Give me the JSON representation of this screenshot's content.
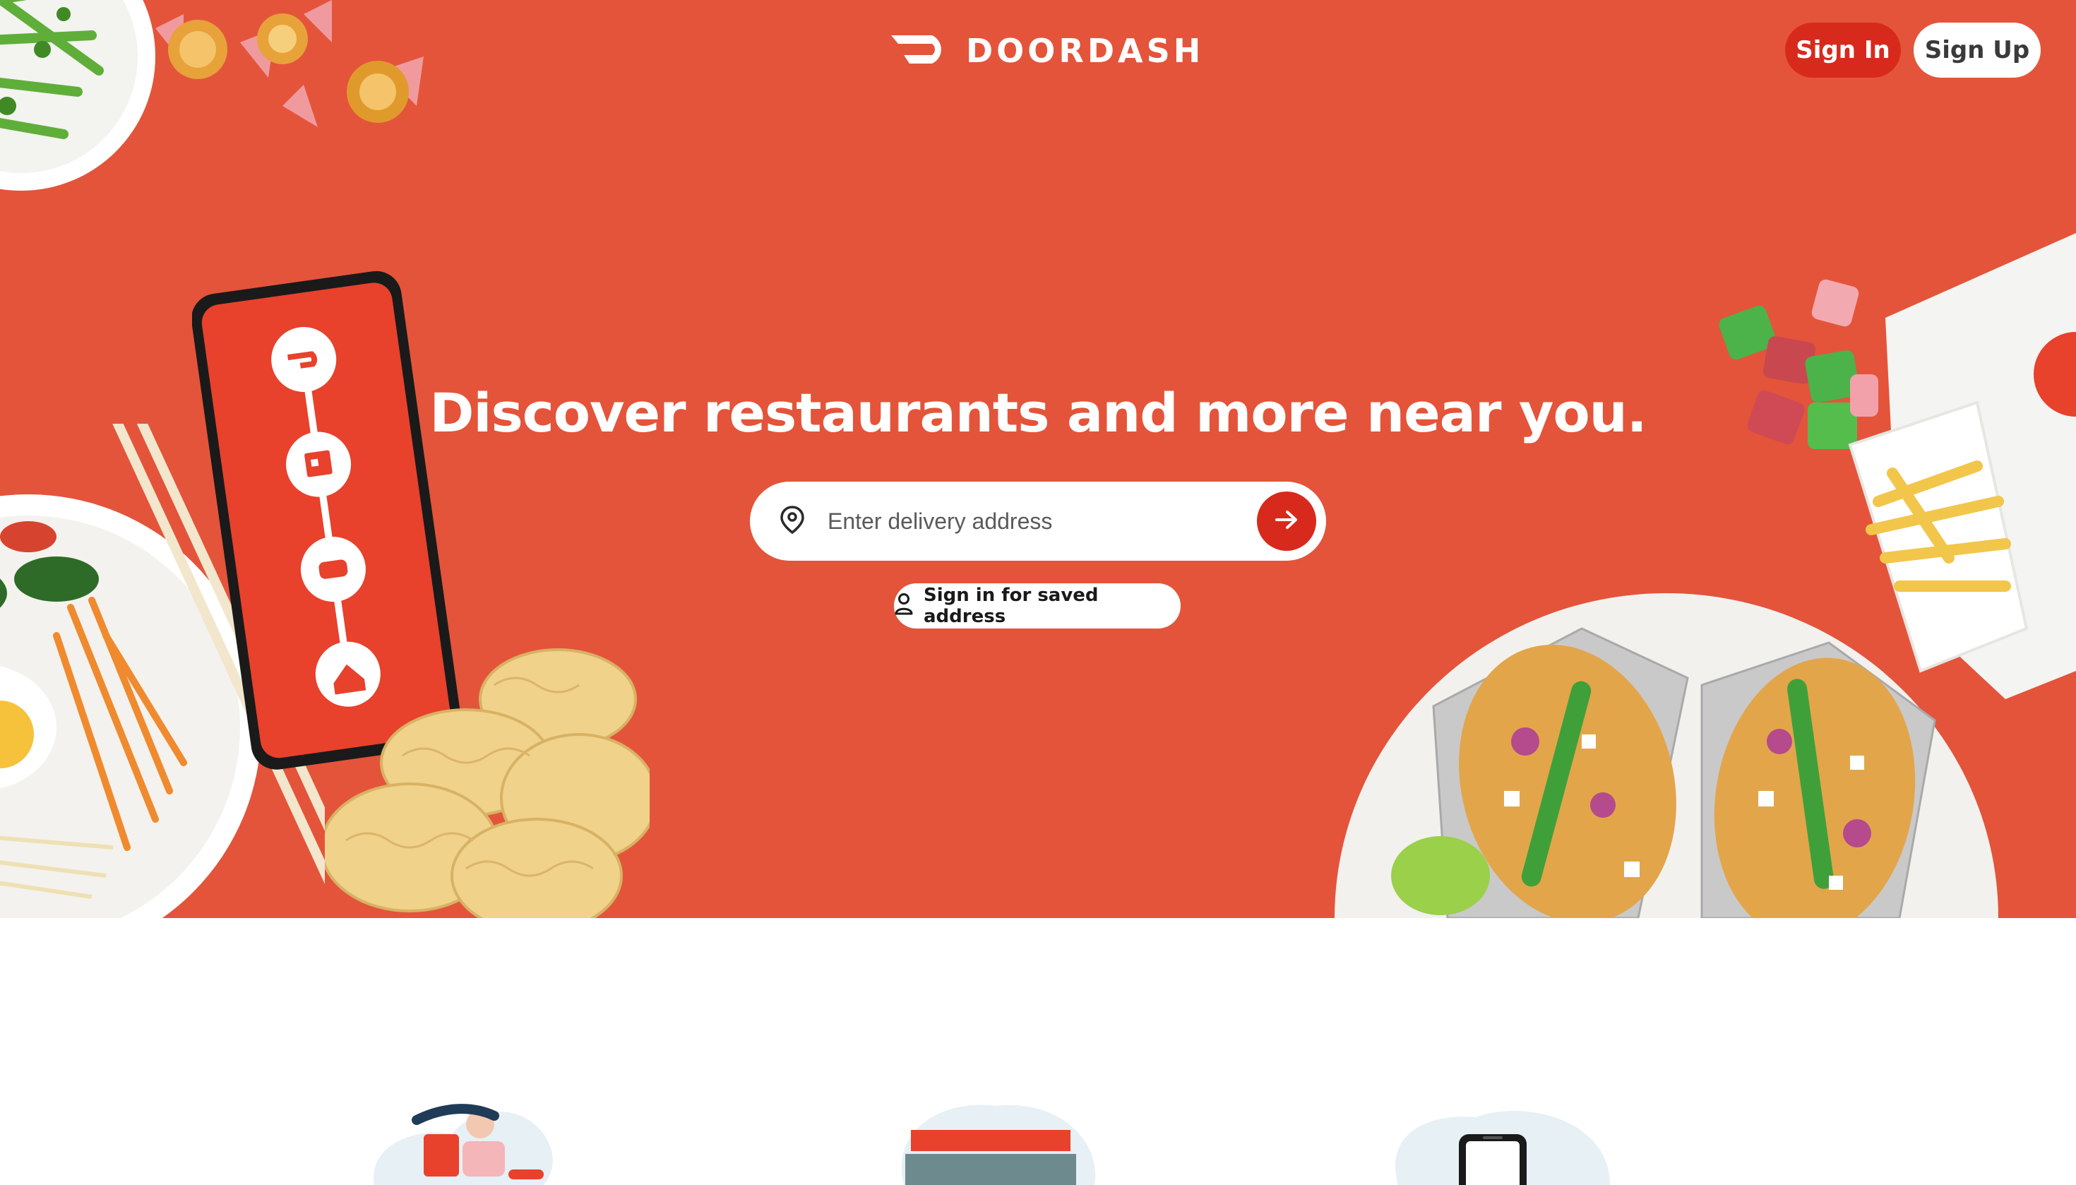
{
  "header": {
    "brand": "DOORDASH",
    "sign_in_label": "Sign In",
    "sign_up_label": "Sign Up"
  },
  "hero": {
    "headline": "Discover restaurants and more near you.",
    "search": {
      "placeholder": "Enter delivery address",
      "value": ""
    },
    "saved_address_label": "Sign in for saved address"
  },
  "icons": {
    "logo": "doordash-logo-icon",
    "location": "map-pin-icon",
    "submit": "arrow-right-icon",
    "user": "user-icon"
  },
  "colors": {
    "hero_background": "#e4543a",
    "accent": "#d82a1c",
    "white": "#ffffff"
  }
}
